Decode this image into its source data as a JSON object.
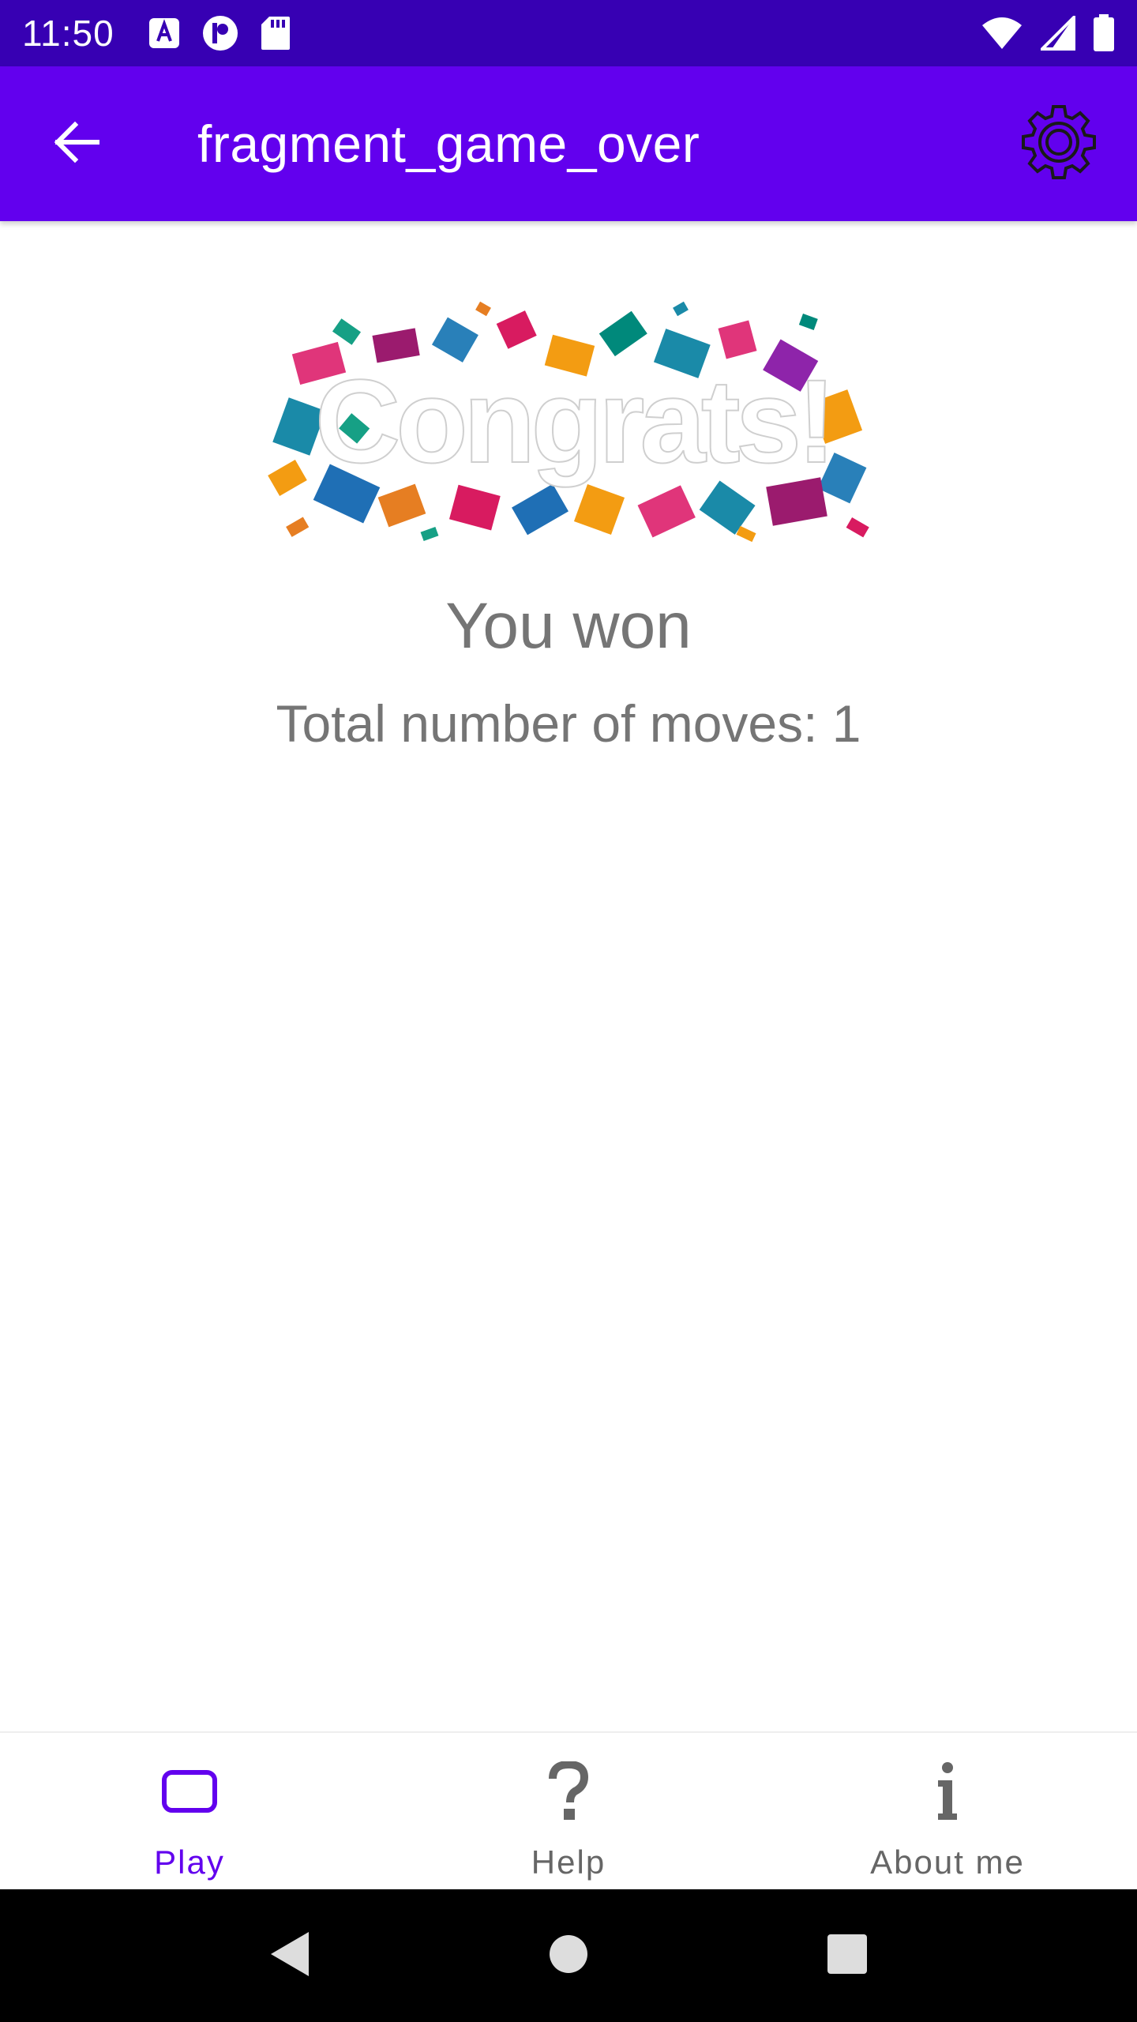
{
  "status_bar": {
    "time": "11:50",
    "left_icons": [
      "font-a-icon",
      "p-circle-icon",
      "sd-card-icon"
    ],
    "right_icons": [
      "wifi-icon",
      "signal-icon",
      "battery-icon"
    ]
  },
  "app_bar": {
    "title": "fragment_game_over",
    "back_icon": "arrow-back-icon",
    "settings_icon": "gear-icon",
    "color": "#6200ee"
  },
  "content": {
    "banner_text": "Congrats!",
    "headline": "You won",
    "moves_text": "Total number of moves: 1"
  },
  "bottom_nav": {
    "items": [
      {
        "label": "Play",
        "icon": "play-rect-icon",
        "active": true
      },
      {
        "label": "Help",
        "icon": "question-icon",
        "active": false
      },
      {
        "label": "About me",
        "icon": "info-icon",
        "active": false
      }
    ],
    "active_color": "#6200ee",
    "inactive_color": "#666666"
  },
  "system_nav": {
    "buttons": [
      "back-triangle-icon",
      "home-circle-icon",
      "recents-square-icon"
    ]
  }
}
